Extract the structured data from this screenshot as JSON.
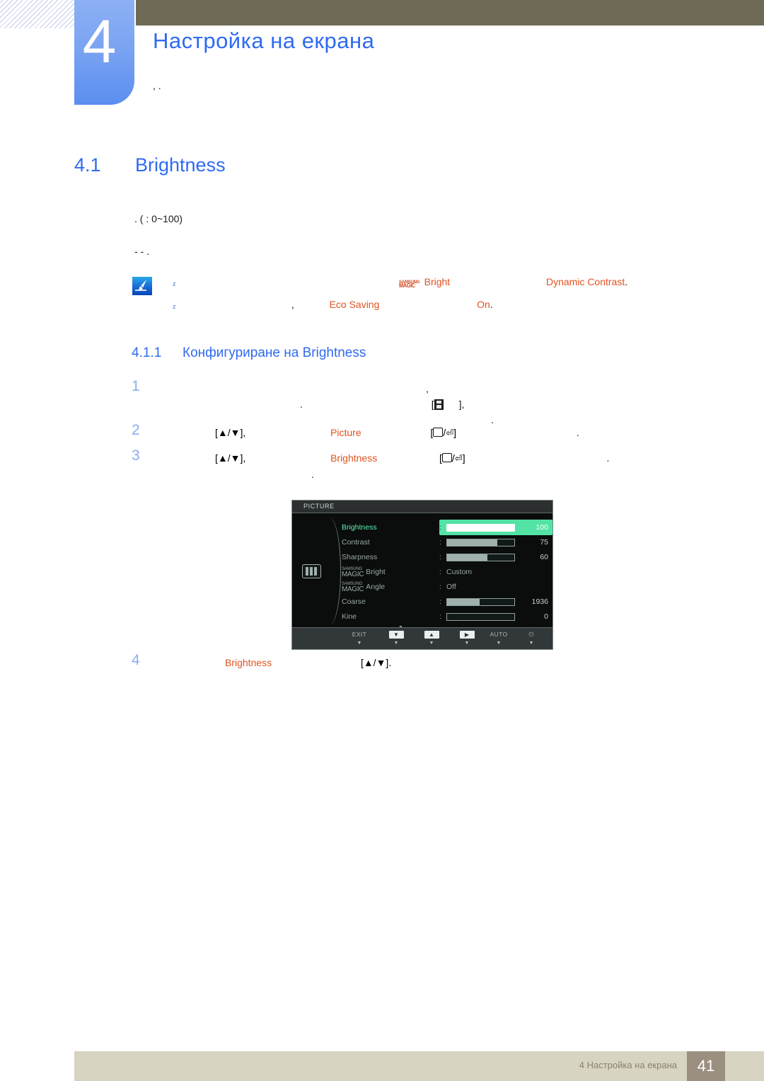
{
  "chapter": {
    "number": "4",
    "title": "Настройка на екрана",
    "intro": ",                                                                                 ."
  },
  "section": {
    "number": "4.1",
    "title": "Brightness",
    "paragraph_1": ". (                                 : 0~100)",
    "paragraph_2": "-                                                                                 -        ."
  },
  "note": {
    "icon_name": "note-pen-icon",
    "bullet": "z",
    "line_1_pre": "",
    "line_1_magic_top": "SAMSUNG",
    "line_1_magic_bottom": "MAGIC",
    "line_1_kw1": "Bright",
    "line_1_mid": "",
    "line_1_kw2": "Dynamic Contrast",
    "line_1_end": ".",
    "line_2_pre": ",",
    "line_2_kw1": "Eco Saving",
    "line_2_mid": "",
    "line_2_kw2": "On",
    "line_2_end": "."
  },
  "subsection": {
    "number": "4.1.1",
    "title_cyrillic": "Конфигуриране  на",
    "title_en": "Brightness"
  },
  "steps": [
    {
      "n": "1",
      "line_1": ",",
      "line_2_pre": ".",
      "key_glyph": "menu-key",
      "line_2_post": "],",
      "line_2_end": "."
    },
    {
      "n": "2",
      "keys": "[▲/▼],",
      "kw": "Picture",
      "keys2_open": "[",
      "keys2_sep": "/",
      "keys2_close": "]",
      "end": "."
    },
    {
      "n": "3",
      "keys": "[▲/▼],",
      "kw": "Brightness",
      "keys2_open": "[",
      "keys2_sep": "/",
      "keys2_close": "]",
      "end": ".",
      "tail": "."
    },
    {
      "n": "4",
      "kw": "Brightness",
      "keys": "[▲/▼]."
    }
  ],
  "osd": {
    "title": "PICTURE",
    "side_icon_name": "picture-bars-icon",
    "more_indicator": "▼",
    "rows": [
      {
        "label": "Brightness",
        "type": "bar",
        "value": "100",
        "fill_pct": 100,
        "selected": true
      },
      {
        "label": "Contrast",
        "type": "bar",
        "value": "75",
        "fill_pct": 75,
        "selected": false
      },
      {
        "label": "Sharpness",
        "type": "bar",
        "value": "60",
        "fill_pct": 60,
        "selected": false
      },
      {
        "label": "Bright",
        "type": "option",
        "magic_top": "SAMSUNG",
        "magic_bottom": "MAGIC",
        "value": "Custom",
        "selected": false
      },
      {
        "label": "Angle",
        "type": "option",
        "magic_top": "SAMSUNG",
        "magic_bottom": "MAGIC",
        "value": "Off",
        "selected": false
      },
      {
        "label": "Coarse",
        "type": "bar",
        "value": "1936",
        "fill_pct": 48,
        "selected": false
      },
      {
        "label": "Kine",
        "type": "bar",
        "value": "0",
        "fill_pct": 0,
        "selected": false
      }
    ],
    "buttons": [
      {
        "icon": "EXIT",
        "icon_kind": "plain",
        "sub": "▼",
        "name": "exit"
      },
      {
        "icon": "▼",
        "icon_kind": "boxed",
        "sub": "▼",
        "name": "down"
      },
      {
        "icon": "▲",
        "icon_kind": "boxed",
        "sub": "▼",
        "name": "up"
      },
      {
        "icon": "▶",
        "icon_kind": "boxed",
        "sub": "▼",
        "name": "enter"
      },
      {
        "icon": "AUTO",
        "icon_kind": "plain",
        "sub": "▼",
        "name": "auto"
      },
      {
        "icon": "⏻",
        "icon_kind": "plain",
        "sub": "▼",
        "name": "power"
      }
    ]
  },
  "footer": {
    "text": "4 Настройка  на  екрана",
    "page": "41"
  },
  "colors": {
    "accent_blue": "#2f6bf0",
    "keyword_orange": "#e1521f",
    "olive": "#6e6a55",
    "footer_bg": "#d8d4c2",
    "page_badge": "#9b8f80",
    "osd_highlight": "#52e3a5"
  }
}
